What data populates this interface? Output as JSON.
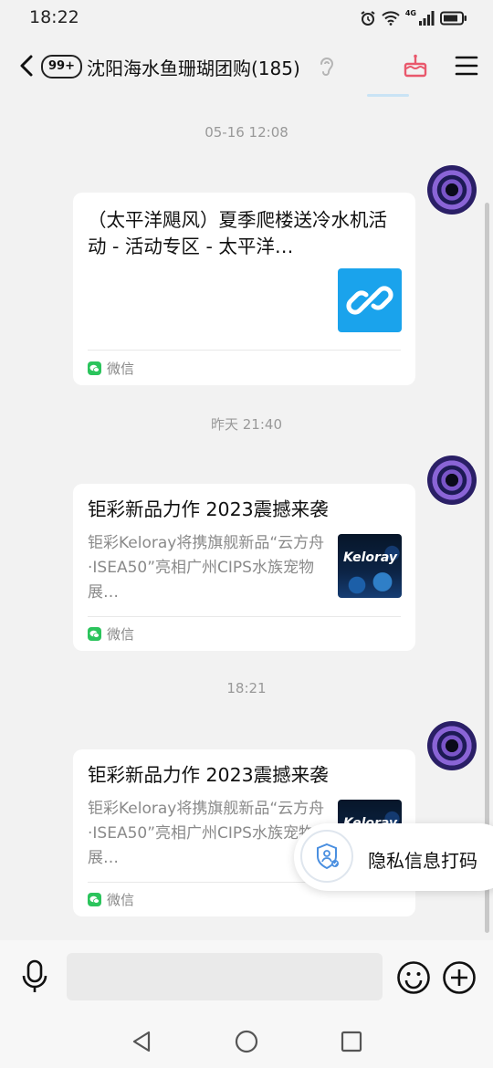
{
  "status": {
    "time": "18:22",
    "network": "4G"
  },
  "header": {
    "badge": "99+",
    "title": "沈阳海水鱼珊瑚团购(185)"
  },
  "messages": [
    {
      "timestamp": "05-16 12:08",
      "title": "（太平洋飓风）夏季爬楼送冷水机活动 - 活动专区 - 太平洋…",
      "desc": "",
      "thumb": "link-icon",
      "source": "微信"
    },
    {
      "timestamp": "昨天 21:40",
      "title": "钜彩新品力作 2023震撼来袭",
      "desc": "钜彩Keloray将携旗舰新品“云方舟·ISEA50”亮相广州CIPS水族宠物展…",
      "thumb": "Keloray",
      "source": "微信"
    },
    {
      "timestamp": "18:21",
      "title": "钜彩新品力作 2023震撼来袭",
      "desc": "钜彩Keloray将携旗舰新品“云方舟·ISEA50”亮相广州CIPS水族宠物展…",
      "thumb": "Keloray",
      "source": "微信"
    }
  ],
  "privacy": {
    "label": "隐私信息打码"
  },
  "colors": {
    "wechat_green": "#2bc45c",
    "link_blue": "#1aa3ec",
    "cake_pink": "#e9586c"
  }
}
